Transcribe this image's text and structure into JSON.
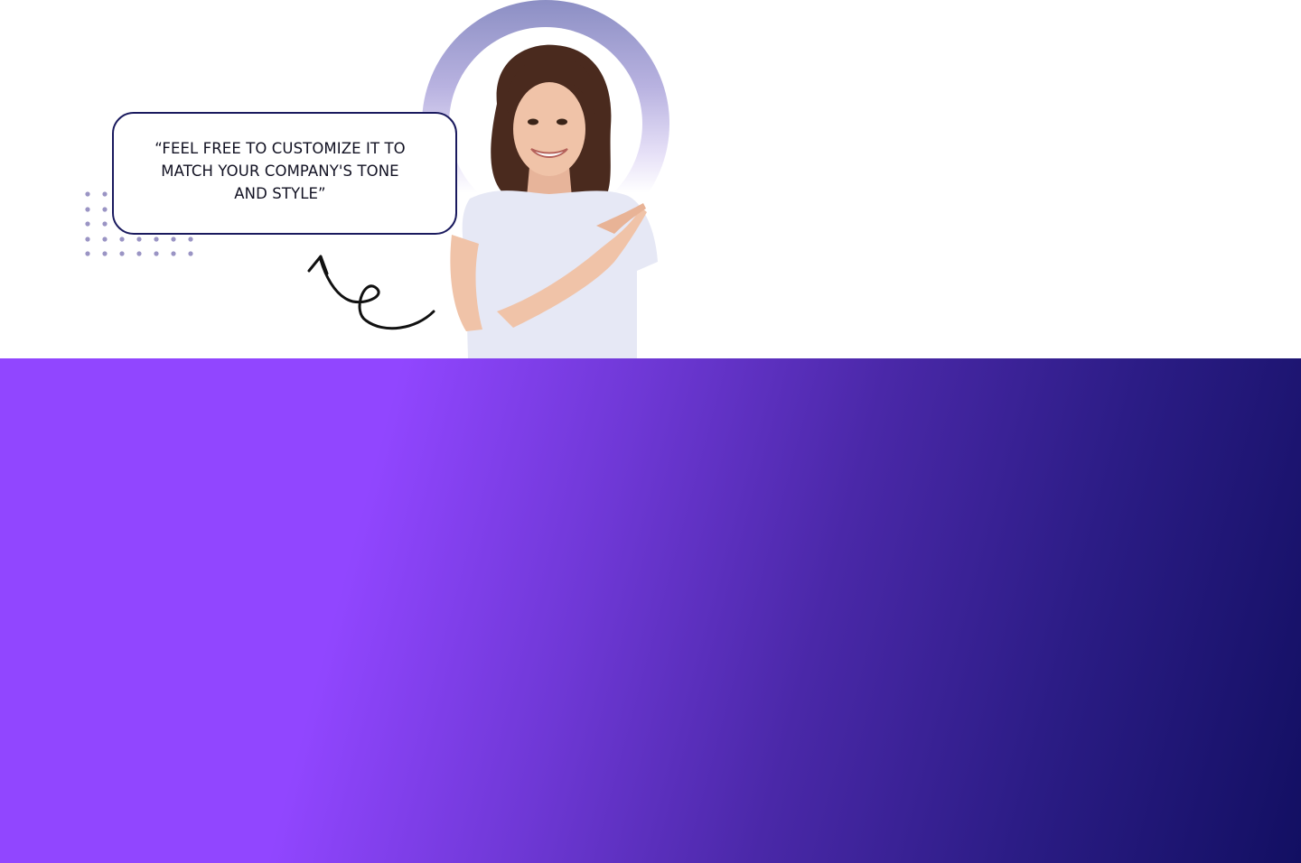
{
  "hero": {
    "quote": "“FEEL FREE TO CUSTOMIZE IT TO MATCH YOUR COMPANY'S TONE AND STYLE”",
    "quote_color": "#111122",
    "bubble_border_color": "#1a1a5e",
    "person_shirt_color": "#e6e8f5",
    "dot_color": "#9a94c4"
  },
  "panel": {
    "gradient_start": "#9146ff",
    "gradient_end": "#120f62"
  }
}
